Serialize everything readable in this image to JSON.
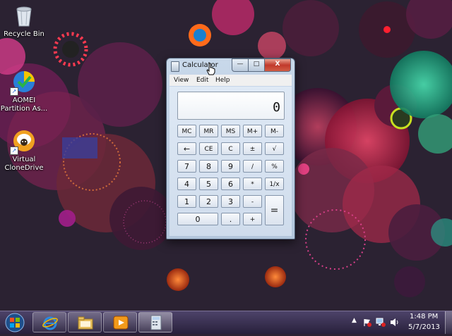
{
  "desktop": {
    "icons": [
      {
        "label": "Recycle Bin",
        "icon": "recycle-bin-icon"
      },
      {
        "label": "AOMEI Partition As...",
        "icon": "aomei-partition-icon"
      },
      {
        "label": "Virtual CloneDrive",
        "icon": "virtual-clonedrive-sheep-icon"
      }
    ]
  },
  "calculator": {
    "title": "Calculator",
    "controls": {
      "minimize": "—",
      "maximize": "□",
      "close": "X"
    },
    "menu": [
      "View",
      "Edit",
      "Help"
    ],
    "display": "0",
    "keys": [
      [
        "MC",
        "MR",
        "MS",
        "M+",
        "M-"
      ],
      [
        "←",
        "CE",
        "C",
        "±",
        "√"
      ],
      [
        "7",
        "8",
        "9",
        "/",
        "%"
      ],
      [
        "4",
        "5",
        "6",
        "*",
        "1/x"
      ],
      [
        "1",
        "2",
        "3",
        "-",
        "="
      ],
      [
        "0",
        ".",
        "+"
      ]
    ]
  },
  "taskbar": {
    "pinned": [
      {
        "icon": "internet-explorer-icon"
      },
      {
        "icon": "file-explorer-icon"
      },
      {
        "icon": "media-player-icon"
      },
      {
        "icon": "calculator-icon",
        "active": true
      }
    ],
    "tray": {
      "icons": [
        "show-hidden-icons-arrow-icon",
        "action-center-flag-icon",
        "network-icon",
        "volume-icon"
      ],
      "time": "1:48 PM",
      "date": "5/7/2013"
    }
  },
  "colors": {
    "wallpaper_base": "#2c2233",
    "window_frame": "#b9cbe0",
    "close_button": "#c1392b"
  }
}
